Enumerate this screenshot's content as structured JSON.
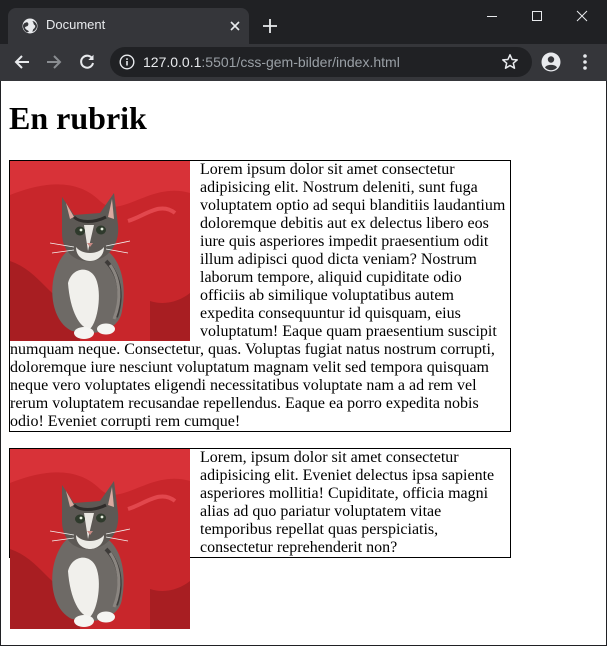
{
  "browser": {
    "tab_title": "Document",
    "url_host": "127.0.0.1",
    "url_rest": ":5501/css-gem-bilder/index.html"
  },
  "page": {
    "heading": "En rubrik",
    "articles": [
      {
        "text": "Lorem ipsum dolor sit amet consectetur adipisicing elit. Nostrum deleniti, sunt fuga voluptatem optio ad sequi blanditiis laudantium doloremque debitis aut ex delectus libero eos iure quis asperiores impedit praesentium odit illum adipisci quod dicta veniam? Nostrum laborum tempore, aliquid cupiditate odio officiis ab similique voluptatibus autem expedita consequuntur id quisquam, eius voluptatum! Eaque quam praesentium suscipit numquam neque. Consectetur, quas. Voluptas fugiat natus nostrum corrupti, doloremque iure nesciunt voluptatum magnam velit sed tempora quisquam neque vero voluptates eligendi necessitatibus voluptate nam a ad rem vel rerum voluptatem recusandae repellendus. Eaque ea porro expedita nobis odio! Eveniet corrupti rem cumque!"
      },
      {
        "text": "Lorem, ipsum dolor sit amet consectetur adipisicing elit. Eveniet delectus ipsa sapiente asperiores mollitia! Cupiditate, officia magni alias ad quo pariatur voluptatem vitae temporibus repellat quas perspiciatis, consectetur reprehenderit non?"
      }
    ]
  },
  "icons": {
    "favicon": "globe-icon",
    "tab_close": "close-icon",
    "new_tab": "plus-icon",
    "back": "arrow-left-icon",
    "forward": "arrow-right-icon",
    "reload": "reload-icon",
    "site_info": "info-icon",
    "bookmark": "star-icon",
    "profile": "account-icon",
    "menu": "kebab-menu-icon",
    "image": "kitten-photo"
  },
  "colors": {
    "frame": "#202124",
    "toolbar": "#35363a",
    "page_bg": "#ffffff",
    "cushion_red": "#c8262b"
  }
}
